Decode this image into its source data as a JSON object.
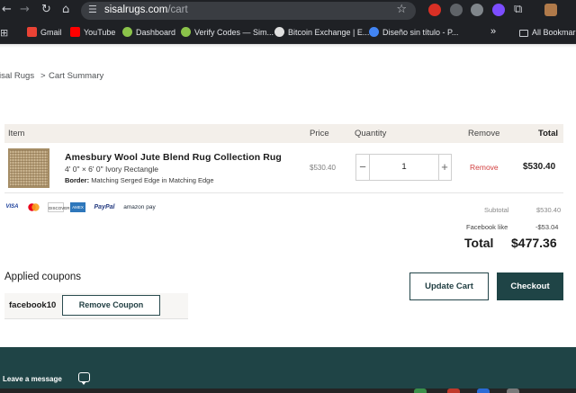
{
  "browser": {
    "url_host": "sisalrugs.com",
    "url_path": "/cart",
    "bookmarks": [
      {
        "label": "Gmail",
        "color": "#ea4335"
      },
      {
        "label": "YouTube",
        "color": "#ff0000"
      },
      {
        "label": "Dashboard",
        "color": "#8bc34a"
      },
      {
        "label": "Verify Codes — Sim...",
        "color": "#8bc34a"
      },
      {
        "label": "Bitcoin Exchange | E...",
        "color": "#e0e0e0"
      },
      {
        "label": "Diseño sin título - P...",
        "color": "#4285f4"
      }
    ],
    "overflow_label": "»",
    "all_bookmarks_label": "All Bookmarks"
  },
  "breadcrumb": {
    "root": "isal Rugs",
    "separator": ">",
    "current": "Cart Summary"
  },
  "table": {
    "headers": {
      "item": "Item",
      "price": "Price",
      "quantity": "Quantity",
      "remove": "Remove",
      "total": "Total"
    },
    "rows": [
      {
        "name": "Amesbury Wool Jute Blend Rug Collection Rug",
        "size": "4' 0\" × 6' 0\" Ivory Rectangle",
        "border_label": "Border:",
        "border_value": "Matching Serged Edge in Matching Edge",
        "price": "$530.40",
        "quantity": "1",
        "remove_label": "Remove",
        "total": "$530.40"
      }
    ]
  },
  "payment_methods": [
    "VISA",
    "MC",
    "DISCOVER",
    "AMEX",
    "PayPal",
    "amazon pay"
  ],
  "summary": {
    "subtotal_label": "Subtotal",
    "subtotal_value": "$530.40",
    "discount_label": "Facebook like",
    "discount_value": "-$53.04",
    "total_label": "Total",
    "total_value": "$477.36"
  },
  "coupons": {
    "title": "Applied coupons",
    "code": "facebook10",
    "remove_label": "Remove Coupon"
  },
  "actions": {
    "update_label": "Update Cart",
    "checkout_label": "Checkout"
  },
  "footer": {
    "leave_message": "Leave a message"
  },
  "colors": {
    "brand_dark": "#1f4446",
    "remove_red": "#d23f3f",
    "header_bg": "#f3efea"
  }
}
